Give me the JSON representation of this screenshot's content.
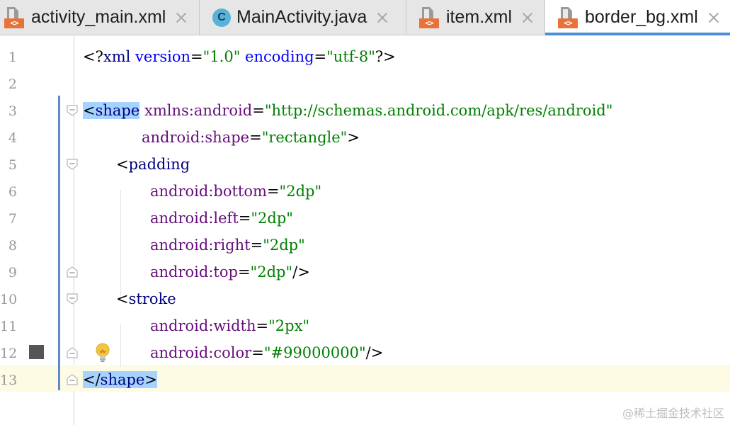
{
  "tabs": [
    {
      "name": "activity_main.xml",
      "icon": "xml-file-icon",
      "active": false
    },
    {
      "name": "MainActivity.java",
      "icon": "java-class-icon",
      "active": false
    },
    {
      "name": "item.xml",
      "icon": "xml-file-icon",
      "active": false
    },
    {
      "name": "border_bg.xml",
      "icon": "xml-file-icon",
      "active": true
    }
  ],
  "icon_labels": {
    "xml_tag": "<>",
    "class_letter": "C"
  },
  "line_numbers": [
    "1",
    "2",
    "3",
    "4",
    "5",
    "6",
    "7",
    "8",
    "9",
    "10",
    "11",
    "12",
    "13"
  ],
  "code": {
    "l1": {
      "open": "<?",
      "tag": "xml",
      "sp1": " ",
      "attr1": "version",
      "eq1": "=",
      "val1": "\"1.0\"",
      "sp2": " ",
      "attr2": "encoding",
      "eq2": "=",
      "val2": "\"utf-8\"",
      "close": "?>"
    },
    "l3": {
      "lt": "<",
      "tag": "shape",
      "sp": " ",
      "ns": "xmlns:",
      "attr": "android",
      "eq": "=",
      "val": "\"http://schemas.android.com/apk/res/android\""
    },
    "l4": {
      "indent": "    ",
      "ns": "android:",
      "attr": "shape",
      "eq": "=",
      "val": "\"rectangle\"",
      "gt": ">"
    },
    "l5": {
      "lt": "<",
      "tag": "padding"
    },
    "l6": {
      "ns": "android:",
      "attr": "bottom",
      "eq": "=",
      "val": "\"2dp\""
    },
    "l7": {
      "ns": "android:",
      "attr": "left",
      "eq": "=",
      "val": "\"2dp\""
    },
    "l8": {
      "ns": "android:",
      "attr": "right",
      "eq": "=",
      "val": "\"2dp\""
    },
    "l9": {
      "ns": "android:",
      "attr": "top",
      "eq": "=",
      "val": "\"2dp\"",
      "close": "/>"
    },
    "l10": {
      "lt": "<",
      "tag": "stroke"
    },
    "l11": {
      "ns": "android:",
      "attr": "width",
      "eq": "=",
      "val": "\"2px\""
    },
    "l12": {
      "ns": "android:",
      "attr": "color",
      "eq": "=",
      "val": "\"#99000000\"",
      "close": "/>"
    },
    "l13": {
      "lt": "</",
      "tag": "shape",
      "gt": ">"
    }
  },
  "watermark": "@稀土掘金技术社区",
  "colors": {
    "tag": "#000080",
    "attribute_namespace": "#660e7a",
    "attribute_value": "#008000",
    "selection": "#a6d2ff",
    "current_line": "#fdfbe3",
    "active_tab_underline": "#4a8fd8",
    "xml_icon_tag": "#e8733a",
    "java_icon": "#57b3d9"
  }
}
